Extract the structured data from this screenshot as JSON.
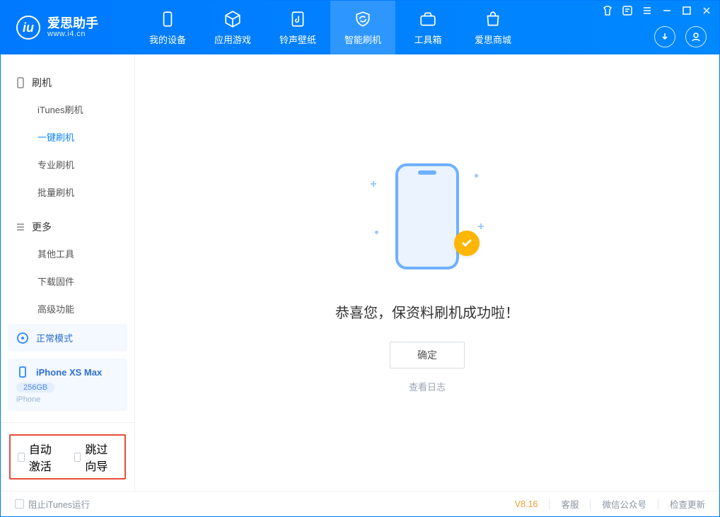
{
  "app": {
    "title": "爱思助手",
    "subtitle": "www.i4.cn"
  },
  "nav": {
    "items": [
      {
        "label": "我的设备"
      },
      {
        "label": "应用游戏"
      },
      {
        "label": "铃声壁纸"
      },
      {
        "label": "智能刷机"
      },
      {
        "label": "工具箱"
      },
      {
        "label": "爱思商城"
      }
    ]
  },
  "sidebar": {
    "group1": {
      "title": "刷机",
      "items": [
        "iTunes刷机",
        "一键刷机",
        "专业刷机",
        "批量刷机"
      ],
      "activeIndex": 1
    },
    "group2": {
      "title": "更多",
      "items": [
        "其他工具",
        "下载固件",
        "高级功能"
      ]
    },
    "mode": {
      "label": "正常模式"
    },
    "device": {
      "name": "iPhone XS Max",
      "storage": "256GB",
      "type": "iPhone"
    },
    "options": {
      "auto_activate": "自动激活",
      "skip_guide": "跳过向导"
    }
  },
  "main": {
    "message": "恭喜您，保资料刷机成功啦！",
    "ok": "确定",
    "view_log": "查看日志"
  },
  "status": {
    "block_itunes": "阻止iTunes运行",
    "version": "V8.16",
    "links": {
      "support": "客服",
      "wechat": "微信公众号",
      "update": "检查更新"
    }
  }
}
